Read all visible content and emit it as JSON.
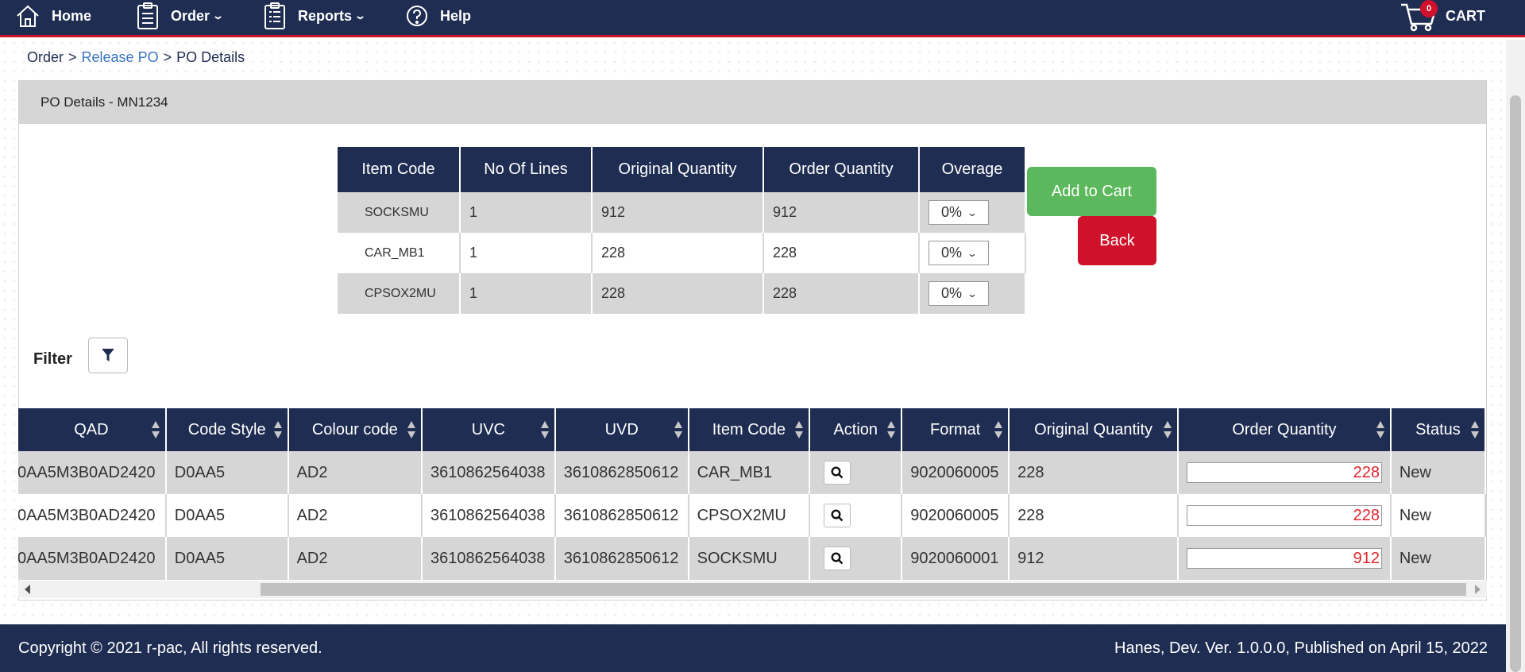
{
  "nav": {
    "home": "Home",
    "order": "Order",
    "reports": "Reports",
    "help": "Help",
    "cart_label": "CART",
    "cart_count": "0"
  },
  "breadcrumb": {
    "order": "Order",
    "sep1": ">",
    "release": "Release PO",
    "sep2": ">",
    "details": "PO Details"
  },
  "panel": {
    "title": "PO Details - MN1234"
  },
  "summary": {
    "headers": [
      "Item Code",
      "No Of Lines",
      "Original Quantity",
      "Order Quantity",
      "Overage"
    ],
    "rows": [
      {
        "item_code": "SOCKSMU",
        "lines": "1",
        "original": "912",
        "order": "912",
        "overage": "0%"
      },
      {
        "item_code": "CAR_MB1",
        "lines": "1",
        "original": "228",
        "order": "228",
        "overage": "0%"
      },
      {
        "item_code": "CPSOX2MU",
        "lines": "1",
        "original": "228",
        "order": "228",
        "overage": "0%"
      }
    ]
  },
  "buttons": {
    "add_to_cart": "Add to Cart",
    "back": "Back"
  },
  "filter": {
    "label": "Filter"
  },
  "grid": {
    "headers": [
      "QAD",
      "Code Style",
      "Colour code",
      "UVC",
      "UVD",
      "Item Code",
      "Action",
      "Format",
      "Original Quantity",
      "Order Quantity",
      "Status"
    ],
    "rows": [
      {
        "qad": "0AA5M3B0AD2420",
        "code_style": "D0AA5",
        "colour": "AD2",
        "uvc": "3610862564038",
        "uvd": "3610862850612",
        "item_code": "CAR_MB1",
        "format": "9020060005",
        "original": "228",
        "order": "228",
        "status": "New"
      },
      {
        "qad": "0AA5M3B0AD2420",
        "code_style": "D0AA5",
        "colour": "AD2",
        "uvc": "3610862564038",
        "uvd": "3610862850612",
        "item_code": "CPSOX2MU",
        "format": "9020060005",
        "original": "228",
        "order": "228",
        "status": "New"
      },
      {
        "qad": "0AA5M3B0AD2420",
        "code_style": "D0AA5",
        "colour": "AD2",
        "uvc": "3610862564038",
        "uvd": "3610862850612",
        "item_code": "SOCKSMU",
        "format": "9020060001",
        "original": "912",
        "order": "912",
        "status": "New"
      }
    ]
  },
  "footer": {
    "copyright": "Copyright © 2021 r-pac, All rights reserved.",
    "version": "Hanes, Dev. Ver. 1.0.0.0, Published on April 15, 2022"
  },
  "colors": {
    "navy": "#1f2d52",
    "accent_red": "#d0112b",
    "green": "#5cb85c",
    "row_gray": "#d6d6d6"
  }
}
